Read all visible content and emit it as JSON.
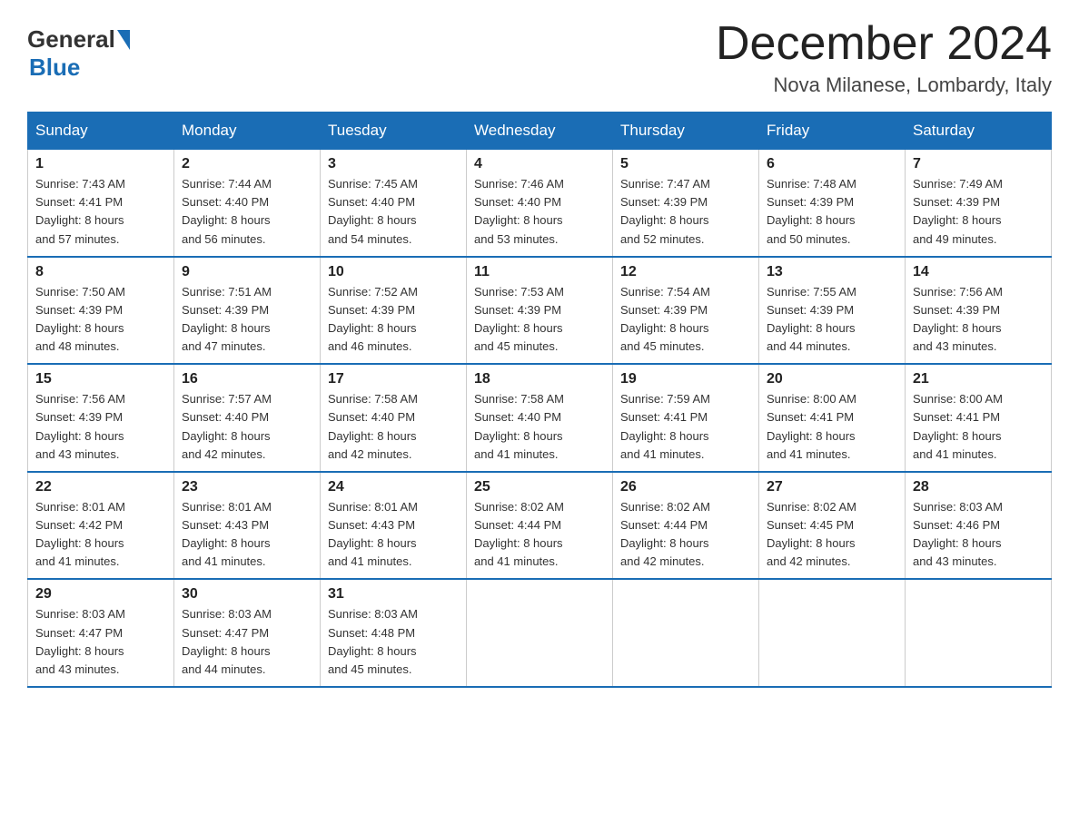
{
  "header": {
    "logo_general": "General",
    "logo_blue": "Blue",
    "main_title": "December 2024",
    "subtitle": "Nova Milanese, Lombardy, Italy"
  },
  "weekdays": [
    "Sunday",
    "Monday",
    "Tuesday",
    "Wednesday",
    "Thursday",
    "Friday",
    "Saturday"
  ],
  "weeks": [
    [
      {
        "day": "1",
        "sunrise": "7:43 AM",
        "sunset": "4:41 PM",
        "daylight": "8 hours and 57 minutes."
      },
      {
        "day": "2",
        "sunrise": "7:44 AM",
        "sunset": "4:40 PM",
        "daylight": "8 hours and 56 minutes."
      },
      {
        "day": "3",
        "sunrise": "7:45 AM",
        "sunset": "4:40 PM",
        "daylight": "8 hours and 54 minutes."
      },
      {
        "day": "4",
        "sunrise": "7:46 AM",
        "sunset": "4:40 PM",
        "daylight": "8 hours and 53 minutes."
      },
      {
        "day": "5",
        "sunrise": "7:47 AM",
        "sunset": "4:39 PM",
        "daylight": "8 hours and 52 minutes."
      },
      {
        "day": "6",
        "sunrise": "7:48 AM",
        "sunset": "4:39 PM",
        "daylight": "8 hours and 50 minutes."
      },
      {
        "day": "7",
        "sunrise": "7:49 AM",
        "sunset": "4:39 PM",
        "daylight": "8 hours and 49 minutes."
      }
    ],
    [
      {
        "day": "8",
        "sunrise": "7:50 AM",
        "sunset": "4:39 PM",
        "daylight": "8 hours and 48 minutes."
      },
      {
        "day": "9",
        "sunrise": "7:51 AM",
        "sunset": "4:39 PM",
        "daylight": "8 hours and 47 minutes."
      },
      {
        "day": "10",
        "sunrise": "7:52 AM",
        "sunset": "4:39 PM",
        "daylight": "8 hours and 46 minutes."
      },
      {
        "day": "11",
        "sunrise": "7:53 AM",
        "sunset": "4:39 PM",
        "daylight": "8 hours and 45 minutes."
      },
      {
        "day": "12",
        "sunrise": "7:54 AM",
        "sunset": "4:39 PM",
        "daylight": "8 hours and 45 minutes."
      },
      {
        "day": "13",
        "sunrise": "7:55 AM",
        "sunset": "4:39 PM",
        "daylight": "8 hours and 44 minutes."
      },
      {
        "day": "14",
        "sunrise": "7:56 AM",
        "sunset": "4:39 PM",
        "daylight": "8 hours and 43 minutes."
      }
    ],
    [
      {
        "day": "15",
        "sunrise": "7:56 AM",
        "sunset": "4:39 PM",
        "daylight": "8 hours and 43 minutes."
      },
      {
        "day": "16",
        "sunrise": "7:57 AM",
        "sunset": "4:40 PM",
        "daylight": "8 hours and 42 minutes."
      },
      {
        "day": "17",
        "sunrise": "7:58 AM",
        "sunset": "4:40 PM",
        "daylight": "8 hours and 42 minutes."
      },
      {
        "day": "18",
        "sunrise": "7:58 AM",
        "sunset": "4:40 PM",
        "daylight": "8 hours and 41 minutes."
      },
      {
        "day": "19",
        "sunrise": "7:59 AM",
        "sunset": "4:41 PM",
        "daylight": "8 hours and 41 minutes."
      },
      {
        "day": "20",
        "sunrise": "8:00 AM",
        "sunset": "4:41 PM",
        "daylight": "8 hours and 41 minutes."
      },
      {
        "day": "21",
        "sunrise": "8:00 AM",
        "sunset": "4:41 PM",
        "daylight": "8 hours and 41 minutes."
      }
    ],
    [
      {
        "day": "22",
        "sunrise": "8:01 AM",
        "sunset": "4:42 PM",
        "daylight": "8 hours and 41 minutes."
      },
      {
        "day": "23",
        "sunrise": "8:01 AM",
        "sunset": "4:43 PM",
        "daylight": "8 hours and 41 minutes."
      },
      {
        "day": "24",
        "sunrise": "8:01 AM",
        "sunset": "4:43 PM",
        "daylight": "8 hours and 41 minutes."
      },
      {
        "day": "25",
        "sunrise": "8:02 AM",
        "sunset": "4:44 PM",
        "daylight": "8 hours and 41 minutes."
      },
      {
        "day": "26",
        "sunrise": "8:02 AM",
        "sunset": "4:44 PM",
        "daylight": "8 hours and 42 minutes."
      },
      {
        "day": "27",
        "sunrise": "8:02 AM",
        "sunset": "4:45 PM",
        "daylight": "8 hours and 42 minutes."
      },
      {
        "day": "28",
        "sunrise": "8:03 AM",
        "sunset": "4:46 PM",
        "daylight": "8 hours and 43 minutes."
      }
    ],
    [
      {
        "day": "29",
        "sunrise": "8:03 AM",
        "sunset": "4:47 PM",
        "daylight": "8 hours and 43 minutes."
      },
      {
        "day": "30",
        "sunrise": "8:03 AM",
        "sunset": "4:47 PM",
        "daylight": "8 hours and 44 minutes."
      },
      {
        "day": "31",
        "sunrise": "8:03 AM",
        "sunset": "4:48 PM",
        "daylight": "8 hours and 45 minutes."
      },
      null,
      null,
      null,
      null
    ]
  ],
  "labels": {
    "sunrise": "Sunrise:",
    "sunset": "Sunset:",
    "daylight": "Daylight:"
  }
}
